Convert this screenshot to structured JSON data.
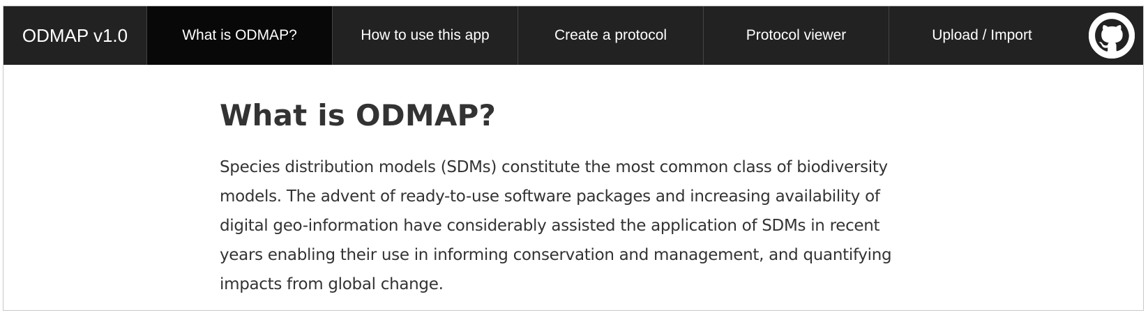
{
  "navbar": {
    "brand": "ODMAP v1.0",
    "tabs": [
      {
        "label": "What is ODMAP?",
        "active": true
      },
      {
        "label": "How to use this app",
        "active": false
      },
      {
        "label": "Create a protocol",
        "active": false
      },
      {
        "label": "Protocol viewer",
        "active": false
      },
      {
        "label": "Upload / Import",
        "active": false
      }
    ],
    "github_icon": "github-icon"
  },
  "main": {
    "title": "What is ODMAP?",
    "paragraph": "Species distribution models (SDMs) constitute the most common class of biodiversity models. The advent of ready-to-use software packages and increasing availability of digital geo-information have considerably assisted the application of SDMs in recent years enabling their use in informing conservation and management, and quantifying impacts from global change."
  },
  "colors": {
    "navbar_bg": "#222222",
    "active_tab_bg": "#080808",
    "text": "#333333"
  }
}
